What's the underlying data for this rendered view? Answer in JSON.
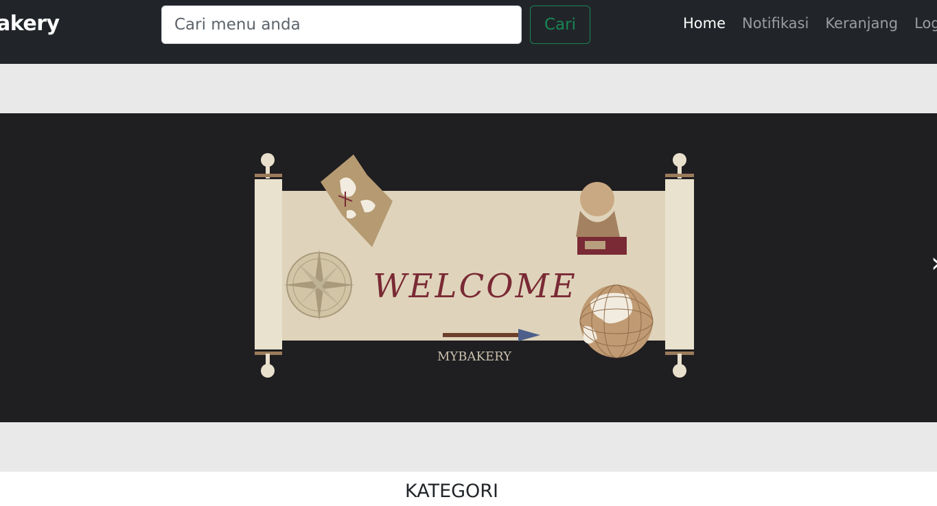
{
  "navbar": {
    "brand": "akery",
    "search": {
      "placeholder": "Cari menu anda",
      "value": ""
    },
    "search_button": "Cari",
    "links": [
      {
        "label": "Home",
        "active": true
      },
      {
        "label": "Notifikasi",
        "active": false
      },
      {
        "label": "Keranjang",
        "active": false
      },
      {
        "label": "Log",
        "active": false
      }
    ]
  },
  "carousel": {
    "welcome_text": "WELCOME",
    "brand_text": "MYBAKERY",
    "next_icon": "chevron-right-icon"
  },
  "section": {
    "title": "KATEGORI"
  },
  "colors": {
    "navbar_bg": "#212529",
    "carousel_bg": "#1f1e21",
    "success_green": "#198754",
    "band_gray": "#e9e9e9",
    "welcome_red": "#7a2a35"
  }
}
